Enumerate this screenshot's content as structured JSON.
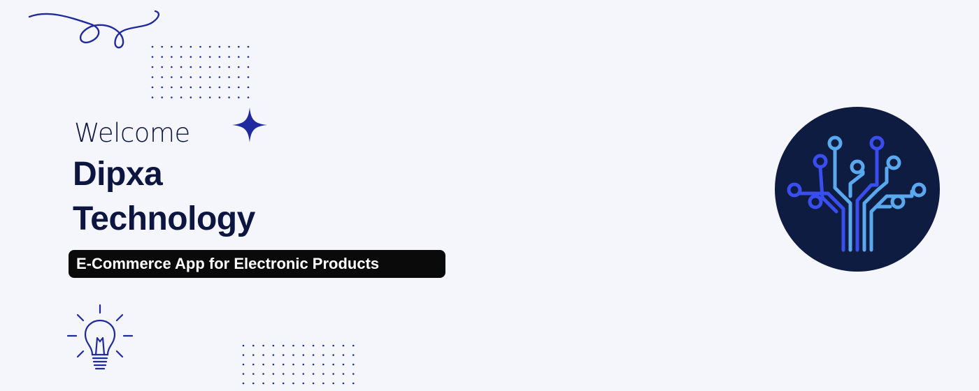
{
  "banner": {
    "welcome": "Welcome",
    "company_line1": "Dipxa",
    "company_line2": "Technology",
    "tagline": "E-Commerce App for Electronic Products"
  },
  "icons": {
    "swirl": "swirl-decoration",
    "sparkle": "sparkle-icon",
    "bulb": "lightbulb-icon",
    "logo": "circuit-tree-logo"
  },
  "colors": {
    "background": "#f5f6fc",
    "navy": "#0d1640",
    "accent_blue": "#1f2a9e",
    "pill": "#0a0a0a",
    "logo_bg": "#0e1c42",
    "circuit_dark": "#3a4ef0",
    "circuit_light": "#5aa8ee"
  }
}
